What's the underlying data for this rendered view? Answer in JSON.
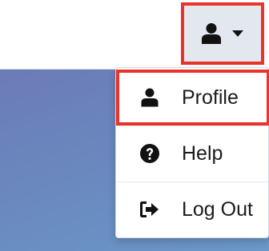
{
  "user_menu": {
    "toggle_icon": "user-icon",
    "caret_icon": "caret-down-icon",
    "items": [
      {
        "label": "Profile",
        "icon": "user-icon"
      },
      {
        "label": "Help",
        "icon": "question-circle-icon"
      },
      {
        "label": "Log Out",
        "icon": "sign-out-icon"
      }
    ]
  },
  "colors": {
    "highlight": "#e8342a",
    "toggle_bg": "#e3e7ee",
    "background_gradient_start": "#6c7bb8",
    "background_gradient_end": "#6a98c8"
  }
}
